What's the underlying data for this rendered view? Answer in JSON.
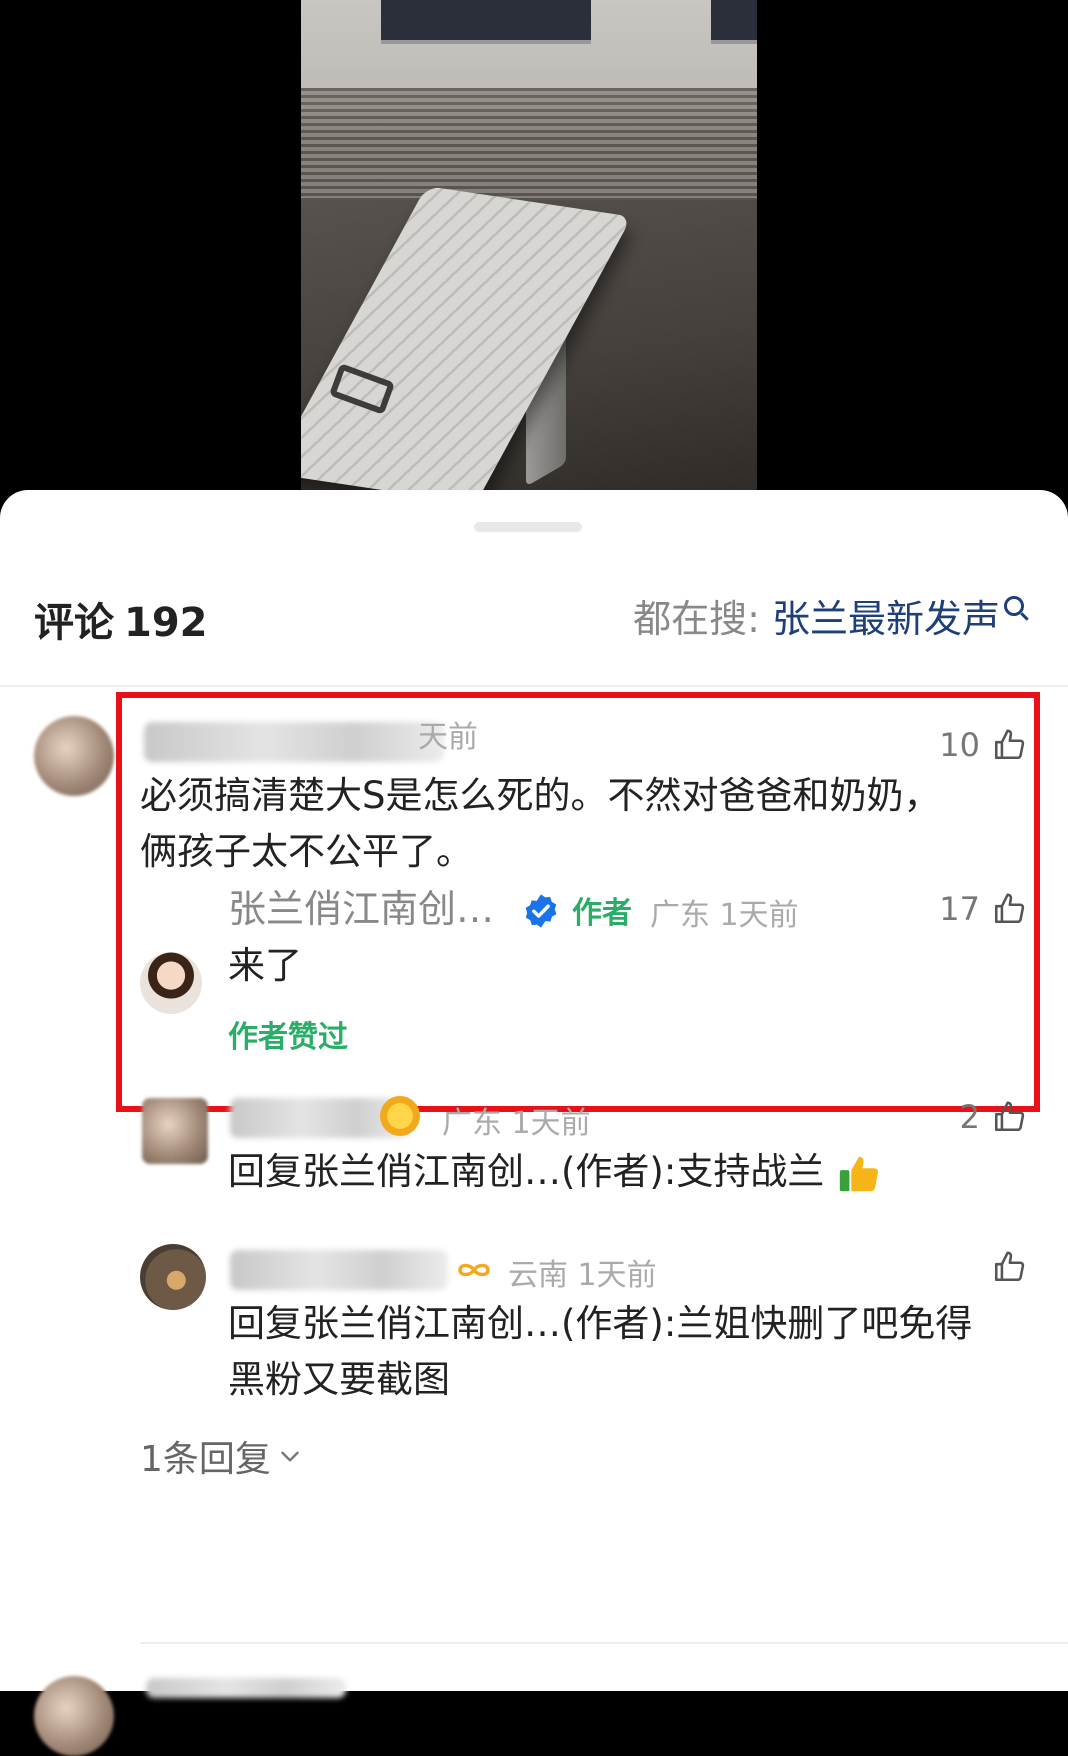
{
  "header": {
    "title": "评论",
    "count": "192",
    "search_prefix": "都在搜:",
    "search_term": "张兰最新发声"
  },
  "comments": [
    {
      "time": "天前",
      "likes": "10",
      "text_line1": "必须搞清楚大S是怎么死的。不然对爸爸和奶奶，",
      "text_line2": "俩孩子太不公平了。",
      "author_reply": {
        "name": "张兰俏江南创…",
        "tag": "作者",
        "location": "广东",
        "time": "1天前",
        "likes": "17",
        "text": "来了",
        "liked_by_author": "作者赞过"
      }
    }
  ],
  "replies": [
    {
      "location": "广东",
      "time": "1天前",
      "likes": "2",
      "text_prefix": "回复张兰俏江南创…(作者):",
      "text": "支持战兰"
    },
    {
      "location": "云南",
      "time": "1天前",
      "likes": "",
      "text_prefix": "回复张兰俏江南创…(作者):",
      "text": "兰姐快删了吧免得",
      "text_line2": "黑粉又要截图"
    }
  ],
  "more_replies": "1条回复",
  "colors": {
    "accent_green": "#2aae67",
    "highlight_red": "#e8111a",
    "search_blue": "#1e3f78",
    "verified_blue": "#1a73e8"
  },
  "icons": [
    "search-icon",
    "thumbs-up-icon",
    "verified-badge-icon",
    "chevron-down-icon",
    "thumbs-up-emoji-icon"
  ]
}
